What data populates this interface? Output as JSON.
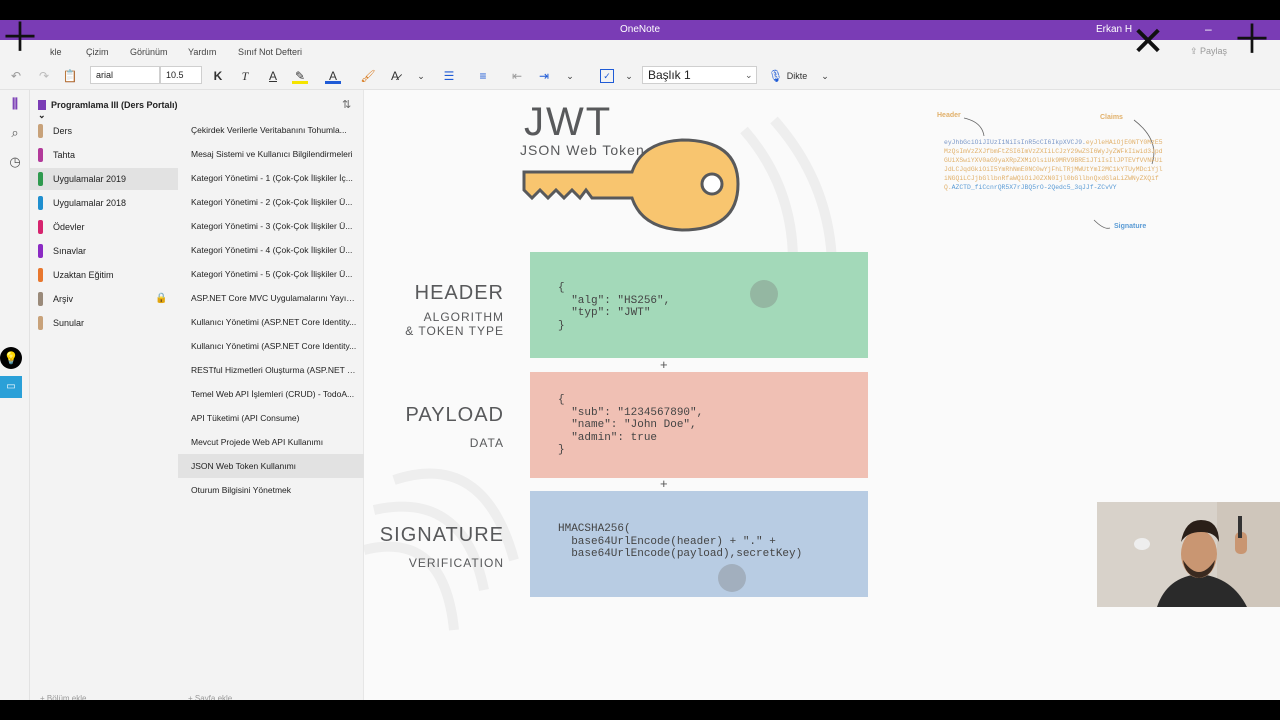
{
  "titlebar": {
    "app_title": "OneNote",
    "user": "Erkan H",
    "minimize": "–",
    "maximize": "□"
  },
  "menu": [
    {
      "name": "menu-ekle",
      "label": "kle"
    },
    {
      "name": "menu-cizim",
      "label": "Çizim"
    },
    {
      "name": "menu-gorunum",
      "label": "Görünüm"
    },
    {
      "name": "menu-yardim",
      "label": "Yardım"
    },
    {
      "name": "menu-sinif-not-defteri",
      "label": "Sınıf Not Defteri"
    }
  ],
  "share_label": "Paylaş",
  "toolbar": {
    "font_name": "arial",
    "font_size": "10.5",
    "style": "Başlık 1",
    "dictate": "Dikte",
    "bold": "K",
    "italic": "T",
    "font_color": "A"
  },
  "notebook": {
    "title": "Programlama III (Ders Portalı)",
    "sections": [
      {
        "label": "Ders",
        "color": "#c8a27a"
      },
      {
        "label": "Tahta",
        "color": "#b23a9a"
      },
      {
        "label": "Uygulamalar 2019",
        "color": "#2f9a4f",
        "selected": true
      },
      {
        "label": "Uygulamalar 2018",
        "color": "#1f8fcf"
      },
      {
        "label": "Ödevler",
        "color": "#d6246e"
      },
      {
        "label": "Sınavlar",
        "color": "#8b2ac3"
      },
      {
        "label": "Uzaktan Eğitim",
        "color": "#e8772e"
      },
      {
        "label": "Arşiv",
        "color": "#9a8a7a",
        "locked": true
      },
      {
        "label": "Sunular",
        "color": "#c8a27a"
      }
    ],
    "add_section": "+ Bölüm ekle"
  },
  "pages": {
    "items": [
      "Çekirdek Verilerle Veritabanını Tohumla...",
      "Mesaj Sistemi ve Kullanıcı Bilgilendirmeleri",
      "Kategori Yönetimi - 1 (Çok-Çok İlişkiler İç...",
      "Kategori Yönetimi - 2 (Çok-Çok İlişkiler Ü...",
      "Kategori Yönetimi - 3 (Çok-Çok İlişkiler Ü...",
      "Kategori Yönetimi - 4 (Çok-Çok İlişkiler Ü...",
      "Kategori Yönetimi - 5 (Çok-Çok İlişkiler Ü...",
      "ASP.NET Core MVC Uygulamalarını Yayın...",
      "Kullanıcı Yönetimi (ASP.NET Core Identity...",
      "Kullanıcı Yönetimi (ASP.NET Core Identity...",
      "RESTful Hizmetleri Oluşturma (ASP.NET C...",
      "Temel Web API İşlemleri (CRUD) - TodoA...",
      "API Tüketimi (API Consume)",
      "Mevcut Projede Web API Kullanımı",
      "JSON Web Token Kullanımı",
      "Oturum Bilgisini Yönetmek"
    ],
    "selected_index": 14,
    "add_page": "+ Sayfa ekle"
  },
  "diagram": {
    "jwt_title": "JWT",
    "jwt_subtitle": "JSON Web Token",
    "header": {
      "title": "HEADER",
      "subtitle": "ALGORITHM\n& TOKEN TYPE",
      "code": "{\n  \"alg\": \"HS256\",\n  \"typ\": \"JWT\"\n}",
      "color": "#a3d9b9"
    },
    "payload": {
      "title": "PAYLOAD",
      "subtitle": "DATA",
      "code": "{\n  \"sub\": \"1234567890\",\n  \"name\": \"John Doe\",\n  \"admin\": true\n}",
      "color": "#f0c0b4"
    },
    "signature": {
      "title": "SIGNATURE",
      "subtitle": "VERIFICATION",
      "code": "HMACSHA256(\n  base64UrlEncode(header) + \".\" +\n  base64UrlEncode(payload),secretKey)",
      "color": "#b8cce3"
    },
    "plus": "+",
    "token": {
      "header_label": "Header",
      "claims_label": "Claims",
      "signature_label": "Signature",
      "header_part": "eyJhbGciOiJIUzI1NiIsInR5cCI6IkpXVCJ9.",
      "claims_part": "eyJleHAiOjE0NTY0MzE5MzQsImVzZXJfbmFtZSI6ImVzZXIiLCJzY29wZSI6WyJyZWFkIiwid3JpdGUiXSwiYXV0aG9yaXRpZXMiOlsiUk9MRV9BRE1JTiIsIlJPTEVfVVNFUiJdLCJqdGkiOiI5YmRhNmE0NC0wYjFhLTRjMWUtYmI2MC1kYTUyMDc1YjliNGQiLCJjbGllbnRfaWQiOiJ0ZXN0Ijl0bGllbnQxdGlaLiZWNyZXQifQ.",
      "signature_part": "AZCTD_fiCcnrQR5X7rJBQ5rO-2Qedc5_3qJJf-ZCvVY"
    }
  },
  "colors": {
    "accent": "#7a3cb5",
    "selected": "#e2e2e2"
  }
}
